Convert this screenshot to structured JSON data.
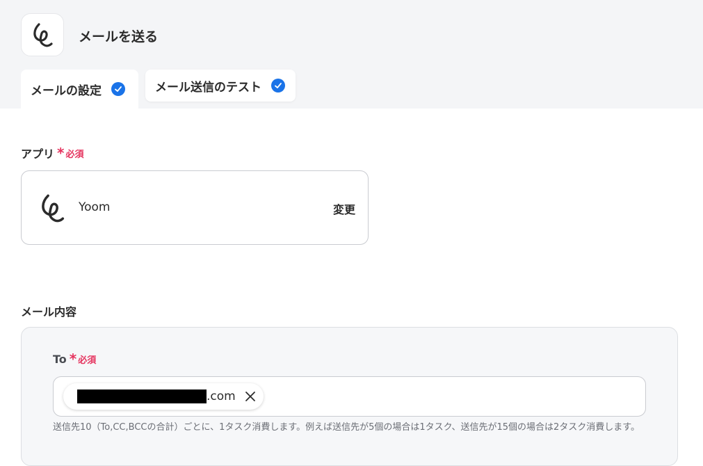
{
  "header": {
    "title": "メールを送る"
  },
  "tabs": [
    {
      "label": "メールの設定"
    },
    {
      "label": "メール送信のテスト"
    }
  ],
  "app_section": {
    "label": "アプリ",
    "required_star": "*",
    "required_text": "必須",
    "app_name": "Yoom",
    "change_label": "変更"
  },
  "mail_section": {
    "label": "メール内容",
    "to": {
      "label": "To",
      "required_star": "*",
      "required_text": "必須",
      "chip_suffix": ".com",
      "helper_text": "送信先10（To,CC,BCCの合計）ごとに、1タスク消費します。例えば送信先が5個の場合は1タスク、送信先が15個の場合は2タスク消費します。"
    }
  },
  "colors": {
    "accent": "#1a73e8",
    "required": "#e5335e",
    "header_bg": "#f4f5f7"
  },
  "icons": {
    "logo": "yoom-logo-icon",
    "check": "check-circle-icon",
    "close": "close-icon"
  }
}
